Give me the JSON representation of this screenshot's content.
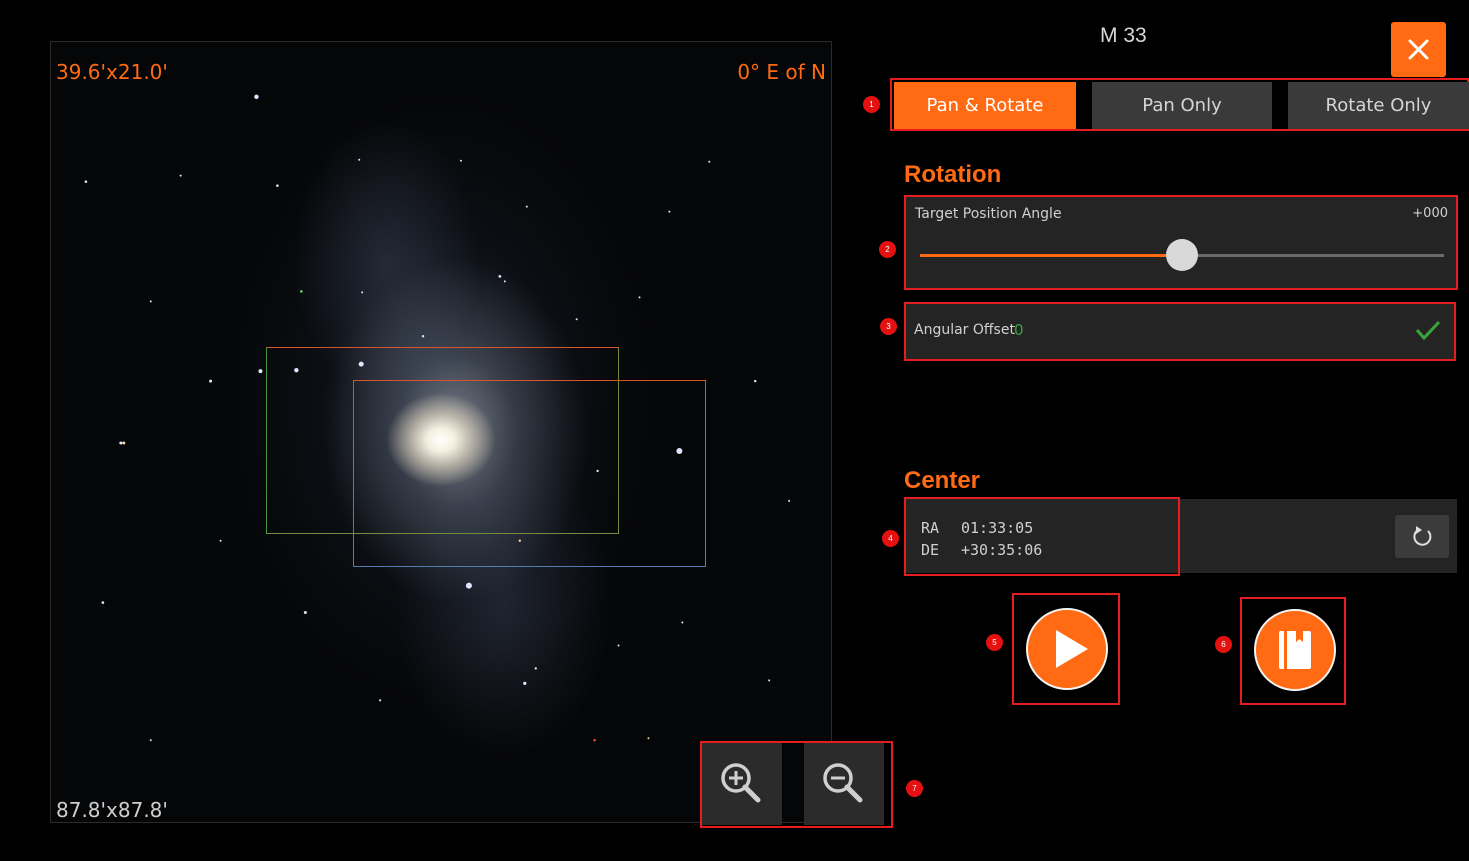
{
  "sky_view": {
    "fov": "39.6'x21.0'",
    "position_angle": "0° E of N",
    "field_size": "87.8'x87.8'"
  },
  "header": {
    "object_name": "M 33",
    "close_icon": "close-icon"
  },
  "modes": {
    "items": [
      {
        "label": "Pan & Rotate",
        "active": true
      },
      {
        "label": "Pan Only",
        "active": false
      },
      {
        "label": "Rotate Only",
        "active": false
      }
    ]
  },
  "rotation": {
    "title": "Rotation",
    "pa_label": "Target Position Angle",
    "pa_value": "+000",
    "slider_fraction": 0.5,
    "offset_label": "Angular Offset",
    "offset_value": "0"
  },
  "center": {
    "title": "Center",
    "ra_label": "RA",
    "ra_value": "01:33:05",
    "de_label": "DE",
    "de_value": "+30:35:06"
  },
  "badges": [
    "1",
    "2",
    "3",
    "4",
    "5",
    "6",
    "7"
  ],
  "colors": {
    "accent": "#ff6a13",
    "annotation": "#e41e1e",
    "panel": "#242424",
    "success": "#3aa33a"
  },
  "icons": {
    "reset": "refresh-icon",
    "play": "play-icon",
    "save": "book-icon",
    "zoom_in": "zoom-in-icon",
    "zoom_out": "zoom-out-icon",
    "confirm": "check-icon"
  }
}
